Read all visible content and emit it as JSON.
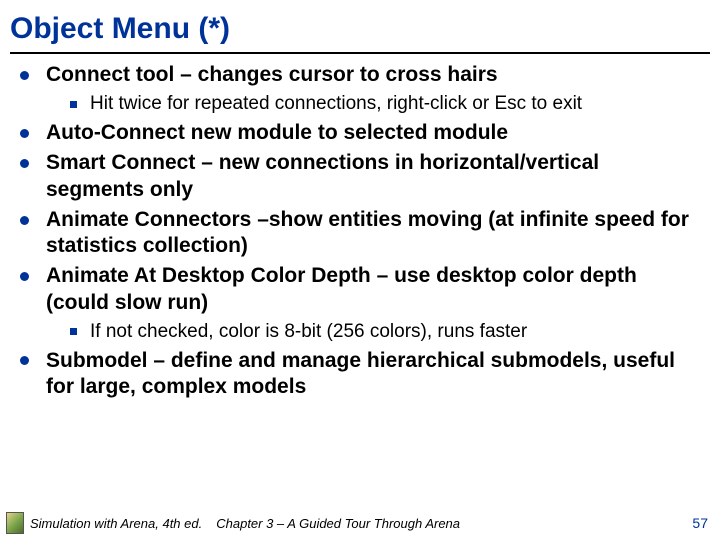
{
  "title": "Object Menu (*)",
  "bullets": {
    "b1": "Connect tool – changes cursor to cross hairs",
    "b1_sub1": "Hit twice for repeated connections, right-click or Esc to exit",
    "b2": "Auto-Connect new module to selected module",
    "b3": "Smart Connect – new connections in horizontal/vertical segments only",
    "b4": "Animate Connectors –show entities moving (at infinite speed for statistics collection)",
    "b5": "Animate At Desktop Color Depth – use desktop color depth (could slow run)",
    "b5_sub1": "If not checked, color is 8-bit (256 colors), runs faster",
    "b6": "Submodel – define and manage hierarchical submodels, useful for large, complex models"
  },
  "footer": {
    "book": "Simulation with Arena, 4th ed.",
    "chapter": "Chapter 3 – A Guided Tour Through Arena",
    "page": "57"
  }
}
